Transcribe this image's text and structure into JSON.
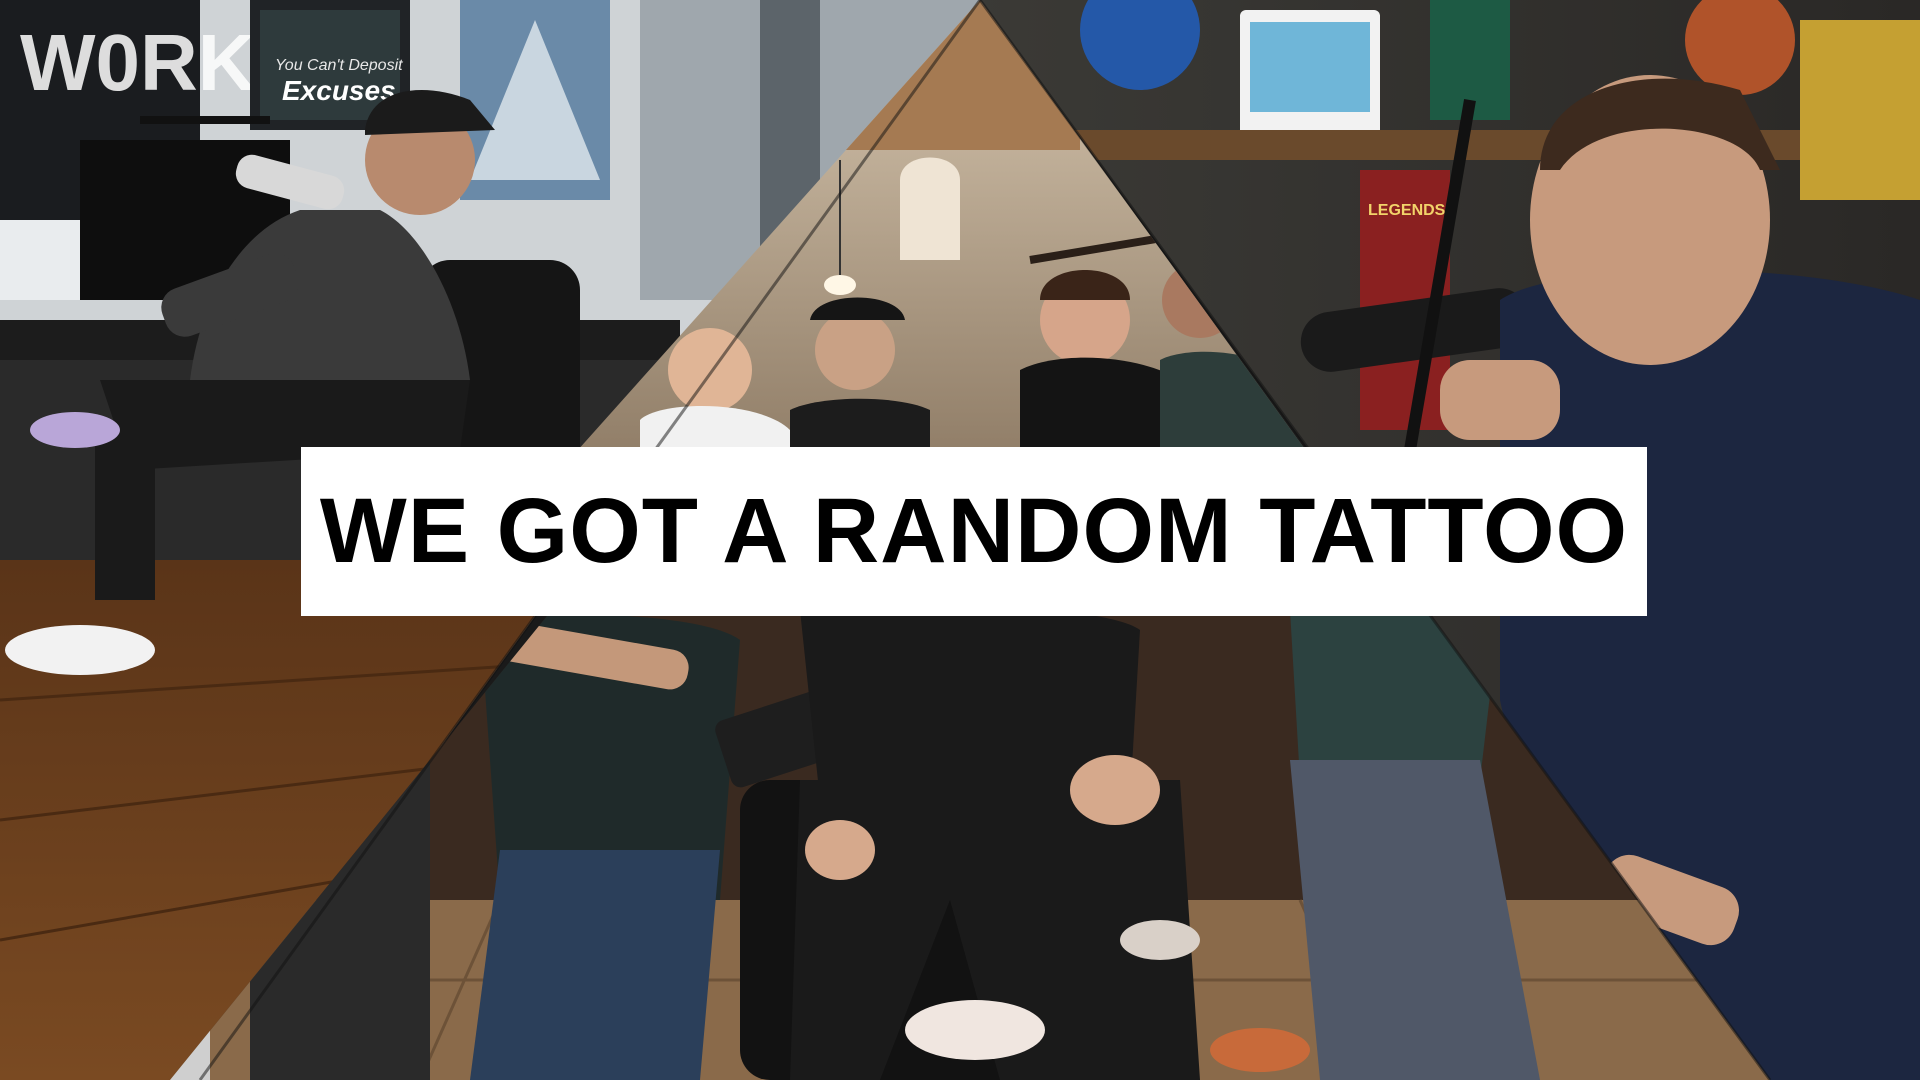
{
  "title": "WE GOT A RANDOM TATTOO",
  "left_panel": {
    "wall_poster_text": "W0RK",
    "monitor_line1": "You Can't Deposit",
    "monitor_line2": "Excuses"
  },
  "right_panel": {
    "box_text": "LEGENDS"
  },
  "colors": {
    "banner_bg": "#ffffff",
    "banner_text": "#000000"
  }
}
